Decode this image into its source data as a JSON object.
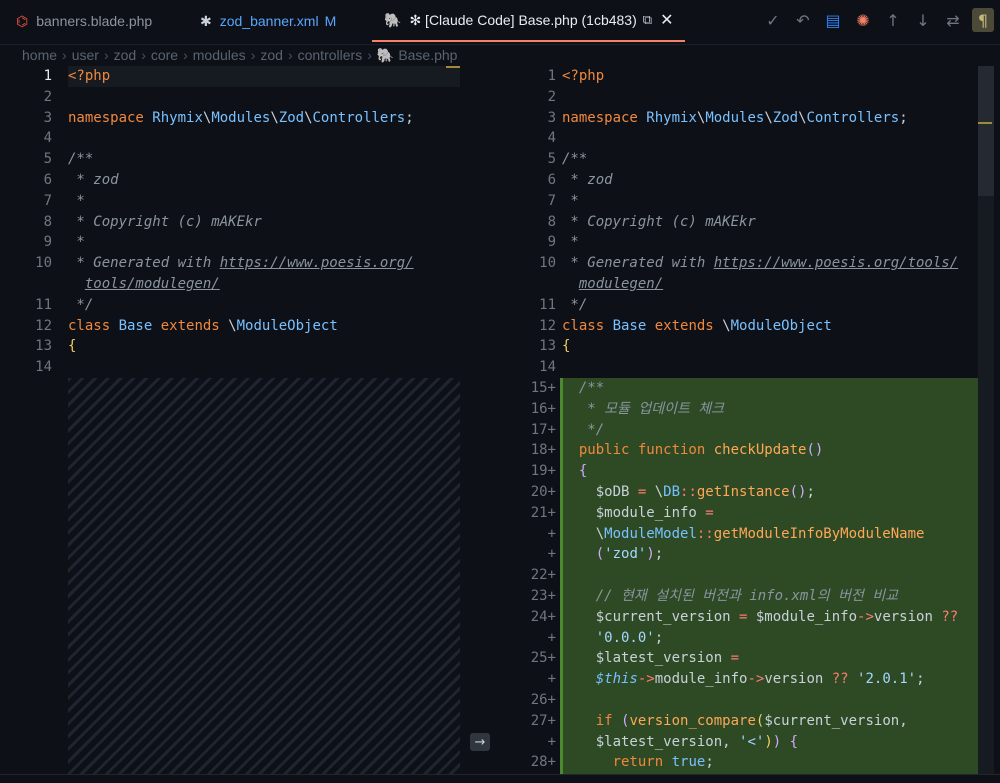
{
  "tabs": [
    {
      "label": "banners.blade.php",
      "icon": "laravel-icon",
      "color": "#f05340"
    },
    {
      "label": "zod_banner.xml",
      "icon": "xml-asterisk-icon",
      "modified": "M",
      "color": "#58a6ff"
    },
    {
      "label": "✻ [Claude Code] Base.php (1cb483)",
      "icon": "php-elephant-icon",
      "extra": "⧉",
      "close": "✕",
      "active": true
    }
  ],
  "toolbar": {
    "icons": [
      "check-icon",
      "undo-icon",
      "database-icon",
      "claude-spark-icon",
      "arrow-up-icon",
      "arrow-down-icon",
      "swap-icon",
      "pilcrow-icon"
    ]
  },
  "breadcrumb": [
    "home",
    "user",
    "zod",
    "core",
    "modules",
    "zod",
    "controllers",
    "Base.php"
  ],
  "left_lines": [
    {
      "n": "1",
      "c": [
        [
          "<?php",
          "kw"
        ]
      ]
    },
    {
      "n": "2",
      "c": []
    },
    {
      "n": "3",
      "c": [
        [
          "namespace ",
          "kw"
        ],
        [
          "Rhymix",
          "ns"
        ],
        [
          "\\",
          "pl"
        ],
        [
          "Modules",
          "ns"
        ],
        [
          "\\",
          "pl"
        ],
        [
          "Zod",
          "ns"
        ],
        [
          "\\",
          "pl"
        ],
        [
          "Controllers",
          "ns"
        ],
        [
          ";",
          "pl"
        ]
      ]
    },
    {
      "n": "4",
      "c": []
    },
    {
      "n": "5",
      "c": [
        [
          "/**",
          "cm"
        ]
      ]
    },
    {
      "n": "6",
      "c": [
        [
          " * zod",
          "cm"
        ]
      ]
    },
    {
      "n": "7",
      "c": [
        [
          " *",
          "cm"
        ]
      ]
    },
    {
      "n": "8",
      "c": [
        [
          " * Copyright (c) mAKEkr",
          "cm"
        ]
      ]
    },
    {
      "n": "9",
      "c": [
        [
          " *",
          "cm"
        ]
      ]
    },
    {
      "n": "10",
      "c": [
        [
          " * Generated with ",
          "cm"
        ],
        [
          "https://www.poesis.org/",
          "lk"
        ]
      ]
    },
    {
      "n": "",
      "c": [
        [
          "  ",
          "cm"
        ],
        [
          "tools/modulegen/",
          "lk"
        ]
      ]
    },
    {
      "n": "11",
      "c": [
        [
          " */",
          "cm"
        ]
      ]
    },
    {
      "n": "12",
      "c": [
        [
          "class ",
          "kw"
        ],
        [
          "Base ",
          "ns"
        ],
        [
          "extends ",
          "kw"
        ],
        [
          "\\",
          "pl"
        ],
        [
          "ModuleObject",
          "ns"
        ]
      ]
    },
    {
      "n": "13",
      "c": [
        [
          "{",
          "br"
        ]
      ]
    },
    {
      "n": "14",
      "c": []
    }
  ],
  "right_lines": [
    {
      "n": "1",
      "c": [
        [
          "<?php",
          "kw"
        ]
      ]
    },
    {
      "n": "2",
      "c": []
    },
    {
      "n": "3",
      "c": [
        [
          "namespace ",
          "kw"
        ],
        [
          "Rhymix",
          "ns"
        ],
        [
          "\\",
          "pl"
        ],
        [
          "Modules",
          "ns"
        ],
        [
          "\\",
          "pl"
        ],
        [
          "Zod",
          "ns"
        ],
        [
          "\\",
          "pl"
        ],
        [
          "Controllers",
          "ns"
        ],
        [
          ";",
          "pl"
        ]
      ]
    },
    {
      "n": "4",
      "c": []
    },
    {
      "n": "5",
      "c": [
        [
          "/**",
          "cm"
        ]
      ]
    },
    {
      "n": "6",
      "c": [
        [
          " * zod",
          "cm"
        ]
      ]
    },
    {
      "n": "7",
      "c": [
        [
          " *",
          "cm"
        ]
      ]
    },
    {
      "n": "8",
      "c": [
        [
          " * Copyright (c) mAKEkr",
          "cm"
        ]
      ]
    },
    {
      "n": "9",
      "c": [
        [
          " *",
          "cm"
        ]
      ]
    },
    {
      "n": "10",
      "c": [
        [
          " * Generated with ",
          "cm"
        ],
        [
          "https://www.poesis.org/tools/",
          "lk"
        ]
      ]
    },
    {
      "n": "",
      "c": [
        [
          "  ",
          "cm"
        ],
        [
          "modulegen/",
          "lk"
        ]
      ]
    },
    {
      "n": "11",
      "c": [
        [
          " */",
          "cm"
        ]
      ]
    },
    {
      "n": "12",
      "c": [
        [
          "class ",
          "kw"
        ],
        [
          "Base ",
          "ns"
        ],
        [
          "extends ",
          "kw"
        ],
        [
          "\\",
          "pl"
        ],
        [
          "ModuleObject",
          "ns"
        ]
      ]
    },
    {
      "n": "13",
      "c": [
        [
          "{",
          "br"
        ]
      ]
    },
    {
      "n": "14",
      "c": []
    },
    {
      "n": "15+",
      "c": [
        [
          "  /**",
          "cm"
        ]
      ]
    },
    {
      "n": "16+",
      "c": [
        [
          "   * 모듈 업데이트 체크",
          "cm"
        ]
      ]
    },
    {
      "n": "17+",
      "c": [
        [
          "   */",
          "cm"
        ]
      ]
    },
    {
      "n": "18+",
      "c": [
        [
          "  public ",
          "kw"
        ],
        [
          "function ",
          "kw"
        ],
        [
          "checkUpdate",
          "fn"
        ],
        [
          "()",
          "br2"
        ]
      ]
    },
    {
      "n": "19+",
      "c": [
        [
          "  ",
          "pl"
        ],
        [
          "{",
          "br2"
        ]
      ]
    },
    {
      "n": "20+",
      "c": [
        [
          "    $oDB ",
          "vr"
        ],
        [
          "= ",
          "op"
        ],
        [
          "\\",
          "pl"
        ],
        [
          "DB",
          "ns"
        ],
        [
          "::",
          "op"
        ],
        [
          "getInstance",
          "fn"
        ],
        [
          "()",
          "br2"
        ],
        [
          ";",
          "pl"
        ]
      ]
    },
    {
      "n": "21+",
      "c": [
        [
          "    $module_info ",
          "vr"
        ],
        [
          "=",
          "op"
        ]
      ]
    },
    {
      "n": "+",
      "c": [
        [
          "    \\",
          "pl"
        ],
        [
          "ModuleModel",
          "ns"
        ],
        [
          "::",
          "op"
        ],
        [
          "getModuleInfoByModuleName",
          "fn"
        ]
      ]
    },
    {
      "n": "+",
      "c": [
        [
          "    ",
          "pl"
        ],
        [
          "(",
          "br2"
        ],
        [
          "'zod'",
          "st"
        ],
        [
          ")",
          "br2"
        ],
        [
          ";",
          "pl"
        ]
      ]
    },
    {
      "n": "22+",
      "c": []
    },
    {
      "n": "23+",
      "c": [
        [
          "    // 현재 설치된 버전과 info.xml의 버전 비교",
          "cm"
        ]
      ]
    },
    {
      "n": "24+",
      "c": [
        [
          "    $current_version ",
          "vr"
        ],
        [
          "= ",
          "op"
        ],
        [
          "$module_info",
          "vr"
        ],
        [
          "->",
          "op"
        ],
        [
          "version ",
          "vr"
        ],
        [
          "??",
          "op"
        ]
      ]
    },
    {
      "n": "+",
      "c": [
        [
          "    ",
          "pl"
        ],
        [
          "'0.0.0'",
          "st"
        ],
        [
          ";",
          "pl"
        ]
      ]
    },
    {
      "n": "25+",
      "c": [
        [
          "    $latest_version ",
          "vr"
        ],
        [
          "=",
          "op"
        ]
      ]
    },
    {
      "n": "+",
      "c": [
        [
          "    ",
          "pl"
        ],
        [
          "$this",
          "this"
        ],
        [
          "->",
          "op"
        ],
        [
          "module_info",
          "vr"
        ],
        [
          "->",
          "op"
        ],
        [
          "version ",
          "vr"
        ],
        [
          "?? ",
          "op"
        ],
        [
          "'2.0.1'",
          "st"
        ],
        [
          ";",
          "pl"
        ]
      ]
    },
    {
      "n": "26+",
      "c": []
    },
    {
      "n": "27+",
      "c": [
        [
          "    ",
          "pl"
        ],
        [
          "if ",
          "kw"
        ],
        [
          "(",
          "br2"
        ],
        [
          "version_compare",
          "fn"
        ],
        [
          "(",
          "br"
        ],
        [
          "$current_version",
          "vr"
        ],
        [
          ",",
          "pl"
        ]
      ]
    },
    {
      "n": "+",
      "c": [
        [
          "    $latest_version",
          "vr"
        ],
        [
          ", ",
          "pl"
        ],
        [
          "'<'",
          "st"
        ],
        [
          ")",
          "br"
        ],
        [
          ") ",
          "br2"
        ],
        [
          "{",
          "br2"
        ]
      ]
    },
    {
      "n": "28+",
      "c": [
        [
          "      ",
          "pl"
        ],
        [
          "return ",
          "kw"
        ],
        [
          "true",
          "ns"
        ],
        [
          ";",
          "pl"
        ]
      ]
    }
  ],
  "colors": {
    "added_bg": "#2d4a25",
    "accent": "#f78166",
    "background": "#0d1117"
  }
}
